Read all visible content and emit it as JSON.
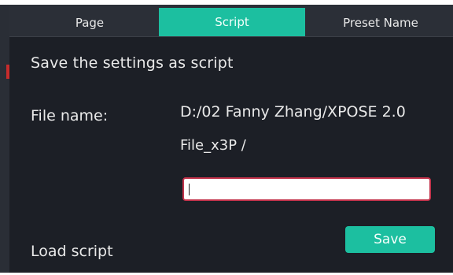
{
  "tabs": [
    {
      "label": "Page",
      "active": false
    },
    {
      "label": "Script",
      "active": true
    },
    {
      "label": "Preset Name",
      "active": false
    }
  ],
  "section": {
    "heading": "Save the settings as script"
  },
  "file": {
    "label": "File name:",
    "path_line1": "D:/02 Fanny Zhang/XPOSE 2.0",
    "path_line2": "File_x3P /",
    "input_value": ""
  },
  "actions": {
    "save_label": "Save",
    "load_label": "Load script"
  },
  "colors": {
    "panel_bg": "#1c1f26",
    "tabbar_bg": "#2b2f37",
    "accent": "#1cbfa0",
    "input_border": "#c2324a",
    "text": "#e9e9e9"
  }
}
